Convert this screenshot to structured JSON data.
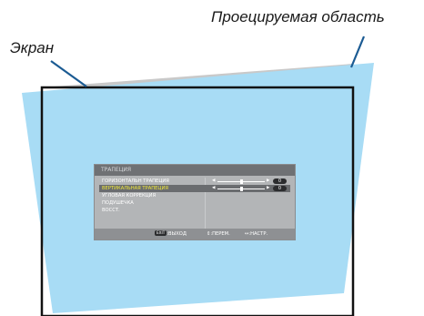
{
  "labels": {
    "projected_area": "Проецируемая область",
    "screen": "Экран"
  },
  "osd": {
    "title": "ТРАПЕЦИЯ",
    "items": [
      {
        "label": "ГОРИЗОНТАЛЬН ТРАПЕЦИЯ",
        "value": "0",
        "level": 0.5,
        "selected": false
      },
      {
        "label": "ВЕРТИКАЛЬНАЯ ТРАПЕЦИЯ",
        "value": "0",
        "level": 0.5,
        "selected": true
      },
      {
        "label": "УГЛОВАЯ КОРРЕКЦИЯ"
      },
      {
        "label": "ПОДУШЕЧКА"
      },
      {
        "label": "ВОССТ."
      }
    ],
    "footer": {
      "exit_key": "EXIT",
      "exit": ":ВЫХОД",
      "move": "⇕:ПЕРЕМ.",
      "adjust": "↔:НАСТР."
    }
  },
  "colors": {
    "projected_area": "#a8dcf5",
    "screen_border": "#111111",
    "screen_top_band": "#c8c8c8",
    "selected_text": "#f2ea3a"
  }
}
